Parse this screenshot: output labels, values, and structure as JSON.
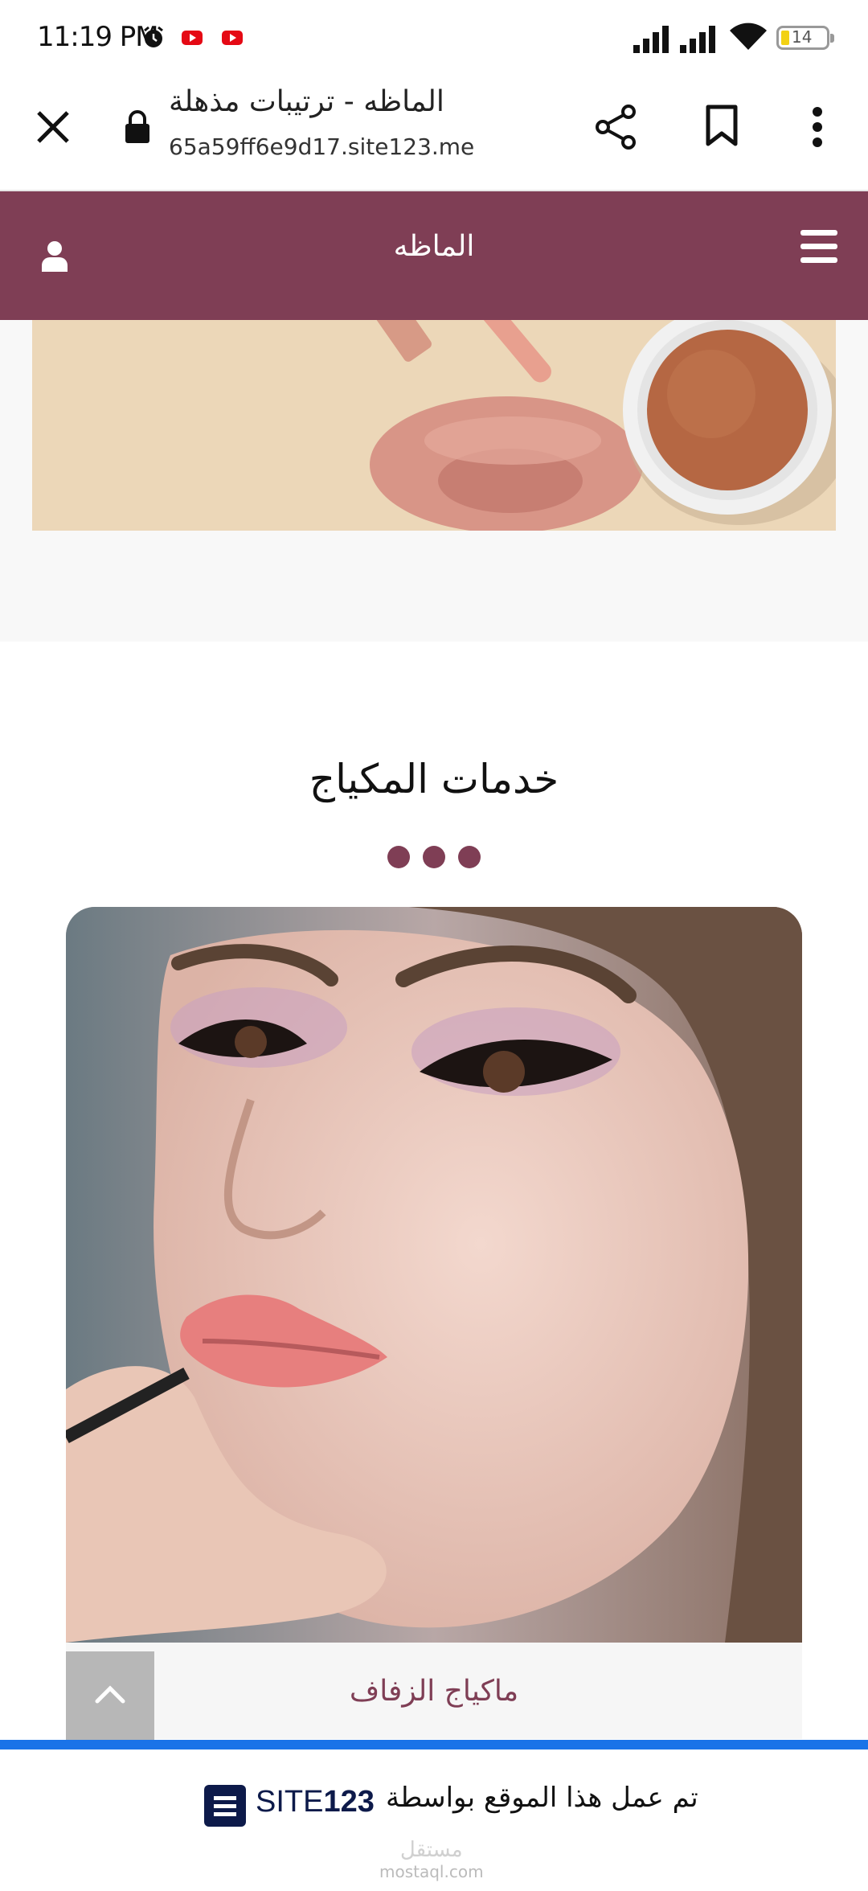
{
  "status_bar": {
    "time": "11:19 PM",
    "battery": "14",
    "icons": [
      "alarm-icon",
      "youtube-icon",
      "youtube-icon",
      "signal-icon",
      "signal-icon",
      "wifi-icon",
      "battery-icon"
    ]
  },
  "browser": {
    "title": "الماظه - ترتيبات مذهلة",
    "url": "65a59ff6e9d17.site123.me",
    "icons": [
      "close-icon",
      "lock-icon",
      "share-icon",
      "bookmark-icon",
      "more-vert-icon"
    ]
  },
  "site_header": {
    "name": "الماظه",
    "background": "#7f3e55",
    "icons": [
      "user-icon",
      "menu-icon"
    ]
  },
  "services": {
    "title": "خدمات المكياج",
    "accent": "#7f3e55",
    "items": [
      {
        "label": "ماكياج الزفاف"
      }
    ]
  },
  "credit": {
    "text": "تم عمل هذا الموقع بواسطة",
    "brand_prefix": "SITE",
    "brand_number": "123",
    "watermark_text": "مستقل",
    "watermark_domain": "mostaql.com",
    "bar_color": "#1a73e8"
  }
}
